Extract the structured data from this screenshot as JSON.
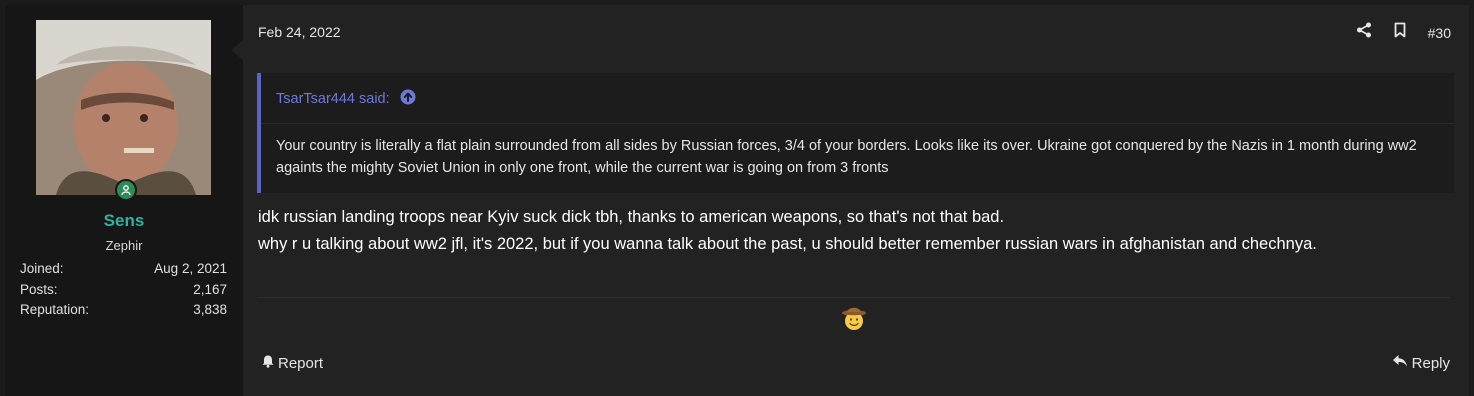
{
  "user": {
    "name": "Sens",
    "title": "Zephir",
    "stats": [
      {
        "label": "Joined:",
        "value": "Aug 2, 2021"
      },
      {
        "label": "Posts:",
        "value": "2,167"
      },
      {
        "label": "Reputation:",
        "value": "3,838"
      }
    ]
  },
  "post": {
    "date": "Feb 24, 2022",
    "number": "#30",
    "quote": {
      "author_said": "TsarTsar444 said:",
      "text": "Your country is literally a flat plain surrounded from all sides by Russian forces, 3/4 of your borders. Looks like its over. Ukraine got conquered by the Nazis in 1 month during ww2 againts the mighty Soviet Union in only one front, while the current war is going on from 3 fronts"
    },
    "message_lines": [
      "idk russian landing troops near Kyiv suck dick tbh, thanks to american weapons, so that's not that bad.",
      "why r u talking about ww2 jfl, it's 2022, but if you wanna talk about the past, u should better remember russian wars in afghanistan and chechnya."
    ],
    "report_label": "Report",
    "reply_label": "Reply"
  },
  "colors": {
    "username": "#2ab3a0",
    "quote_accent": "#5a63c8",
    "online": "#2e8b57"
  },
  "icons": [
    "share-icon",
    "bookmark-icon",
    "arrow-up-circle-icon",
    "bell-icon",
    "reply-icon",
    "cowboy-emoji",
    "online-status-icon"
  ]
}
